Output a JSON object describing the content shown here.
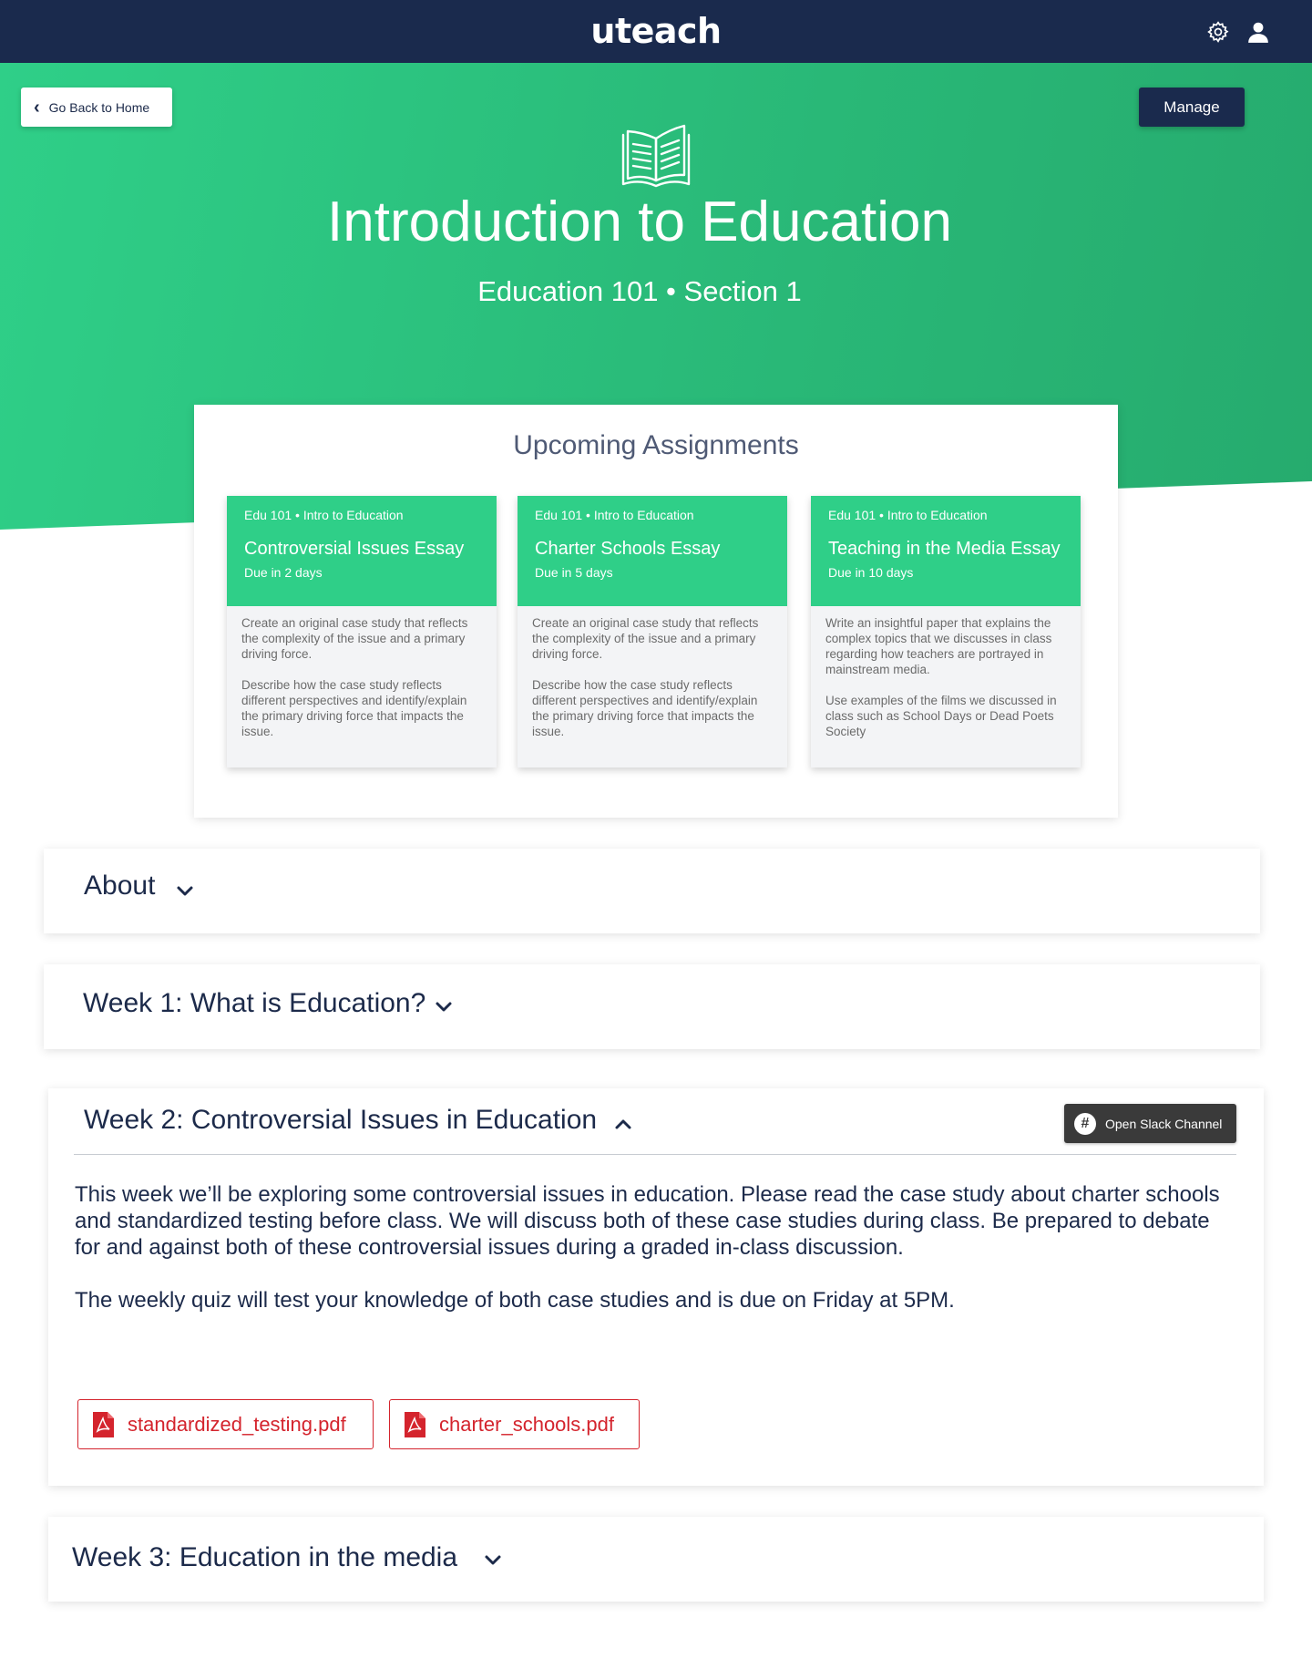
{
  "header": {
    "logo": "uteach",
    "icons": [
      "gear-icon",
      "user-icon"
    ]
  },
  "hero": {
    "back_label": "Go Back to Home",
    "manage_label": "Manage",
    "icon": "open-book-icon",
    "title": "Introduction to Education",
    "subtitle": "Education 101 • Section 1"
  },
  "assignments": {
    "heading": "Upcoming Assignments",
    "cards": [
      {
        "course": "Edu 101 • Intro to Education",
        "title": "Controversial Issues Essay",
        "due": "Due in 2 days",
        "body": "Create an original case study that reflects the complexity of the issue and a primary driving  force.\n\nDescribe how the case study reflects different perspectives and identify/explain the primary driving force that impacts the issue."
      },
      {
        "course": "Edu 101 • Intro to Education",
        "title": "Charter Schools Essay",
        "due": "Due in 5 days",
        "body": "Create an original case study that reflects the complexity of the issue and a primary driving  force.\n\nDescribe how the case study reflects different perspectives and identify/explain the primary driving force that impacts the issue."
      },
      {
        "course": "Edu 101 • Intro to Education",
        "title": "Teaching in the Media Essay",
        "due": "Due in 10 days",
        "body": "Write an insightful paper that explains the complex topics that we discusses in class regarding how teachers are portrayed in mainstream media.\n\nUse examples of the films we discussed in class such as School Days or Dead Poets Society"
      }
    ]
  },
  "sections": {
    "about": {
      "title": "About",
      "expanded": false
    },
    "week1": {
      "title": "Week 1: What is Education?",
      "expanded": false
    },
    "week2": {
      "title": "Week 2: Controversial Issues in Education",
      "expanded": true,
      "slack_label": "Open Slack Channel",
      "paragraphs": [
        "This week we’ll be exploring some controversial issues in education. Please read the case study about charter schools and standardized testing before class. We will discuss both of these case studies during class. Be prepared to debate for and against both of these controversial issues during a graded in-class discussion.",
        "The weekly quiz will test your knowledge of both case studies and is due on Friday at 5PM."
      ],
      "files": [
        "standardized_testing.pdf",
        "charter_schools.pdf"
      ]
    },
    "week3": {
      "title": "Week 3: Education in the media",
      "expanded": false
    }
  },
  "colors": {
    "navy": "#1a2a4d",
    "green": "#2fcf88",
    "pdf_red": "#d4242d"
  }
}
